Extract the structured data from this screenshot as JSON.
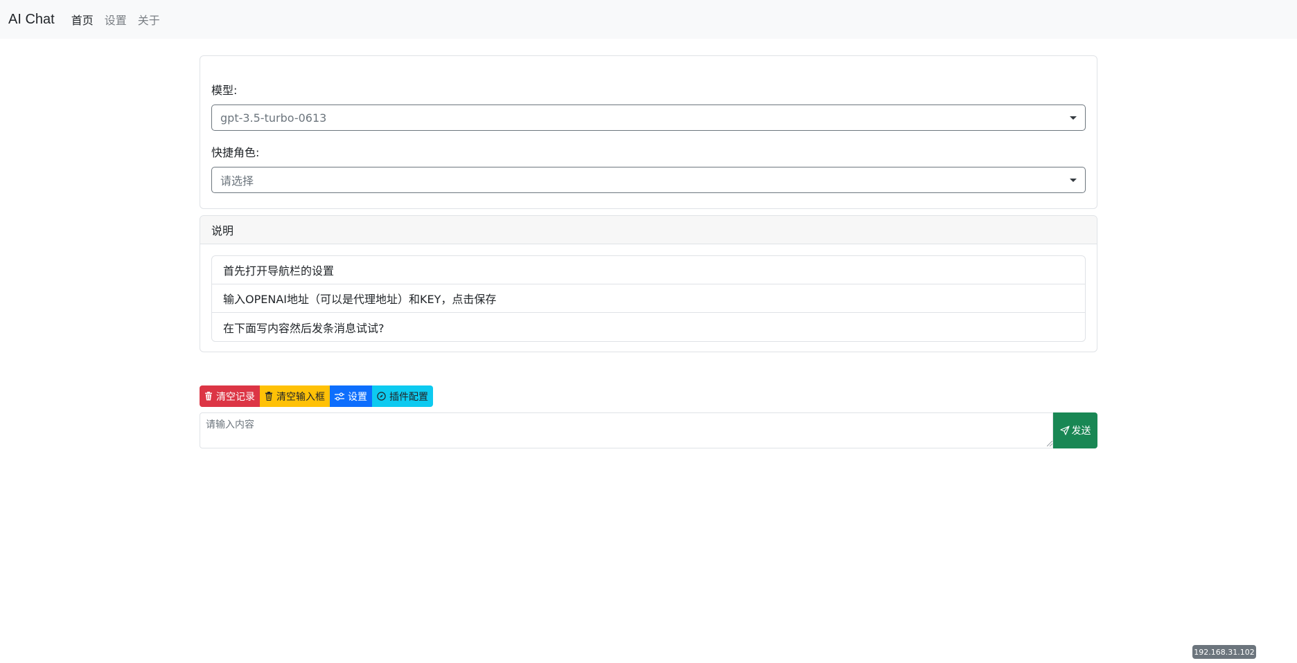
{
  "navbar": {
    "brand": "AI Chat",
    "links": [
      {
        "label": "首页",
        "active": true
      },
      {
        "label": "设置",
        "active": false
      },
      {
        "label": "关于",
        "active": false
      }
    ]
  },
  "form": {
    "model_label": "模型:",
    "model_value": "gpt-3.5-turbo-0613",
    "role_label": "快捷角色:",
    "role_placeholder": "请选择"
  },
  "instructions": {
    "header": "说明",
    "items": [
      "首先打开导航栏的设置",
      "输入OPENAI地址（可以是代理地址）和KEY，点击保存",
      "在下面写内容然后发条消息试试?"
    ]
  },
  "toolbar": {
    "clear_history": "清空记录",
    "clear_input": "清空输入框",
    "settings": "设置",
    "plugin_config": "插件配置"
  },
  "composer": {
    "placeholder": "请输入内容",
    "send_label": "发送"
  },
  "ip_badge": "192.168.31.102",
  "colors": {
    "danger": "#dc3545",
    "warning": "#ffc107",
    "primary": "#0d6efd",
    "info": "#0dcaf0",
    "success": "#198754"
  }
}
